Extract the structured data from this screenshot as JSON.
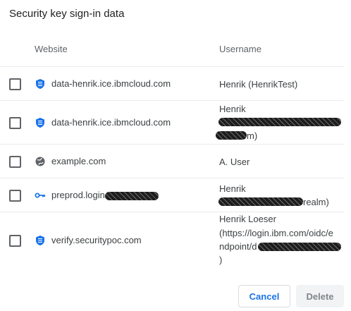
{
  "dialog": {
    "title": "Security key sign-in data"
  },
  "table": {
    "columns": {
      "website": "Website",
      "username": "Username"
    },
    "rows": [
      {
        "site": "data-henrik.ice.ibmcloud.com",
        "site_icon": "shield-icon",
        "username": "Henrik (HenrikTest)"
      },
      {
        "site": "data-henrik.ice.ibmcloud.com",
        "site_icon": "shield-icon",
        "username_line1": "Henrik",
        "username_tail": "m)"
      },
      {
        "site": "example.com",
        "site_icon": "globe-icon",
        "username": "A. User"
      },
      {
        "site": "preprod.login",
        "site_icon": "key-icon",
        "username_line1": "Henrik",
        "username_tail": "realm)"
      },
      {
        "site": "verify.securitypoc.com",
        "site_icon": "shield-icon",
        "username_line1": "Henrik Loeser",
        "username_line2": "(https://login.ibm.com/oidc/e",
        "username_line3": "ndpoint/d",
        "username_line4": ")"
      }
    ]
  },
  "buttons": {
    "cancel": "Cancel",
    "delete": "Delete"
  },
  "colors": {
    "accent": "#1a73e8",
    "icon_blue": "#1a73e8",
    "icon_gray": "#5f6368",
    "disabled_bg": "#f1f3f4",
    "disabled_text": "#80868b"
  }
}
